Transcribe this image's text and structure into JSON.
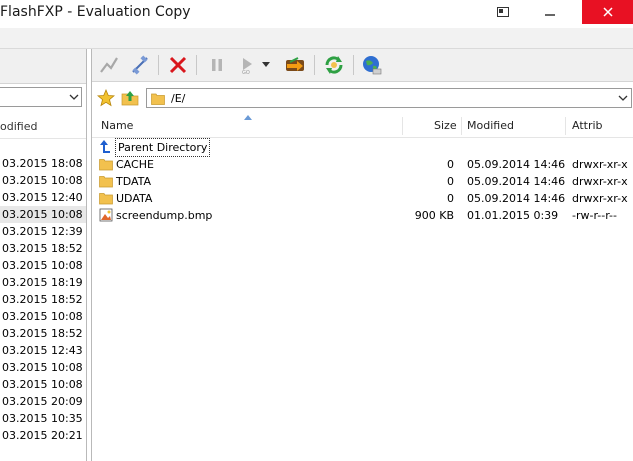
{
  "window": {
    "title": "FlashFXP - Evaluation Copy"
  },
  "left_panel": {
    "header_label": "odified",
    "rows": [
      "03.2015 18:08",
      "03.2015 10:08",
      "03.2015 12:40",
      "03.2015 10:08",
      "03.2015 12:39",
      "03.2015 18:52",
      "03.2015 10:08",
      "03.2015 18:19",
      "03.2015 18:52",
      "03.2015 10:08",
      "03.2015 18:52",
      "03.2015 12:43",
      "03.2015 10:08",
      "03.2015 10:08",
      "03.2015 20:09",
      "03.2015 10:35",
      "03.2015 20:21"
    ],
    "selected_index": 3
  },
  "right_panel": {
    "path": "/E/",
    "columns": {
      "name": "Name",
      "size": "Size",
      "modified": "Modified",
      "attrib": "Attrib"
    },
    "files": [
      {
        "name": "Parent Directory",
        "size": "",
        "modified": "",
        "attrib": "",
        "icon": "parent-directory-icon"
      },
      {
        "name": "CACHE",
        "size": "0",
        "modified": "05.09.2014 14:46",
        "attrib": "drwxr-xr-x",
        "icon": "folder-icon"
      },
      {
        "name": "TDATA",
        "size": "0",
        "modified": "05.09.2014 14:46",
        "attrib": "drwxr-xr-x",
        "icon": "folder-icon"
      },
      {
        "name": "UDATA",
        "size": "0",
        "modified": "05.09.2014 14:46",
        "attrib": "drwxr-xr-x",
        "icon": "folder-icon"
      },
      {
        "name": "screendump.bmp",
        "size": "900 KB",
        "modified": "01.01.2015 0:39",
        "attrib": "-rw-r--r--",
        "icon": "bitmap-file-icon"
      }
    ]
  },
  "colors": {
    "close_button": "#e81123",
    "toolbar_bg": "#f0f0f0",
    "selection": "#e8e8e8",
    "folder": "#f2c14e"
  }
}
